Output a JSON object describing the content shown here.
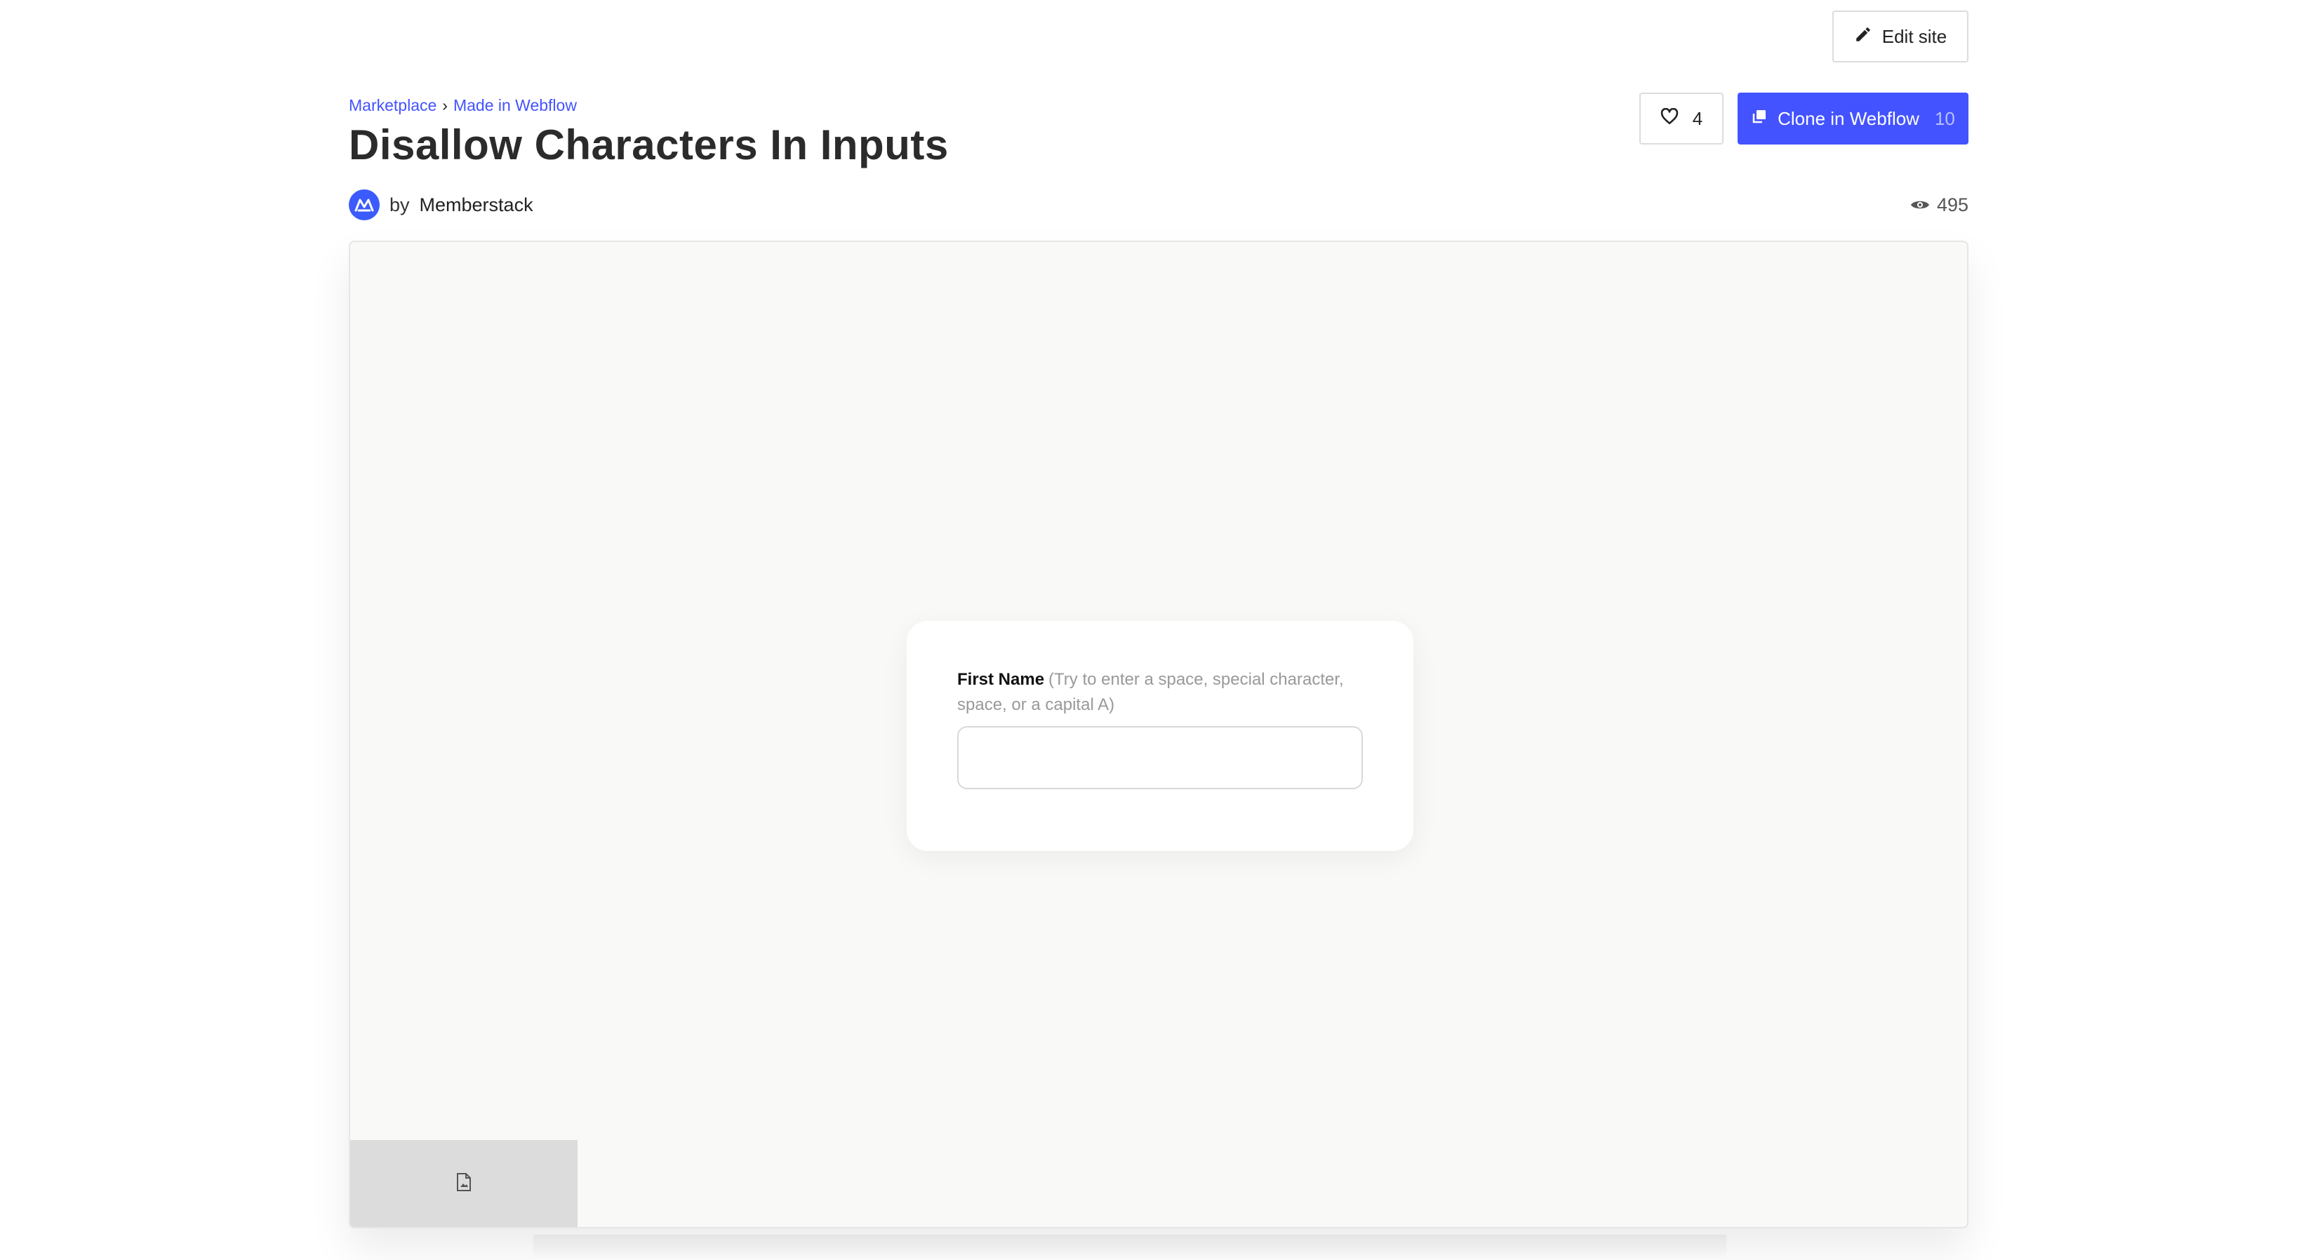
{
  "header": {
    "edit_site_label": "Edit site"
  },
  "breadcrumb": {
    "items": [
      "Marketplace",
      "Made in Webflow"
    ],
    "separator": "›"
  },
  "page": {
    "title": "Disallow Characters In Inputs"
  },
  "author": {
    "prefix": "by",
    "name": "Memberstack"
  },
  "actions": {
    "like_count": "4",
    "clone_label": "Clone in Webflow",
    "clone_count": "10",
    "view_count": "495"
  },
  "preview": {
    "field_label": "First Name",
    "field_hint": "(Try to enter a space, special character, space, or a capital A)",
    "input_value": ""
  },
  "colors": {
    "accent": "#4353ff",
    "avatar": "#3b5bfd"
  },
  "icons": [
    "pencil-icon",
    "heart-icon",
    "clone-icon",
    "eye-icon",
    "image-placeholder-icon",
    "memberstack-logo-icon"
  ]
}
